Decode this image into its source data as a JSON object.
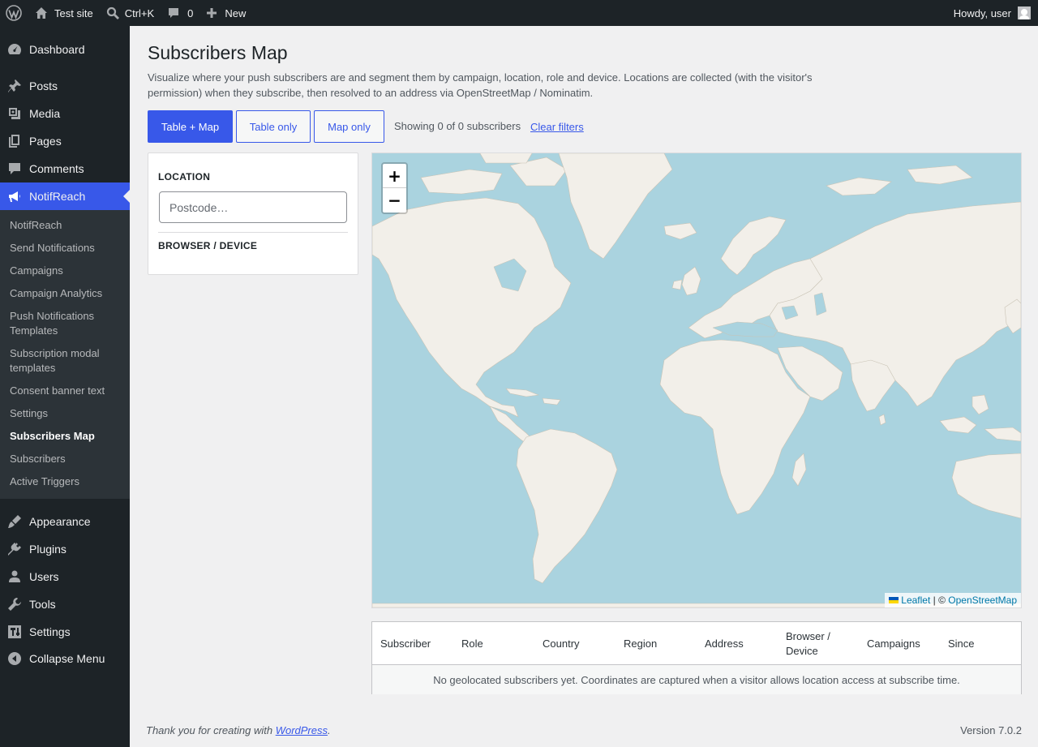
{
  "admin_bar": {
    "site_name": "Test site",
    "search_shortcut": "Ctrl+K",
    "comments_count": "0",
    "new_label": "New",
    "howdy": "Howdy, user"
  },
  "sidebar": {
    "top_items": [
      {
        "label": "Dashboard",
        "icon": "dashboard-icon"
      },
      {
        "label": "Posts",
        "icon": "pushpin-icon"
      },
      {
        "label": "Media",
        "icon": "media-icon"
      },
      {
        "label": "Pages",
        "icon": "pages-icon"
      },
      {
        "label": "Comments",
        "icon": "comment-icon"
      },
      {
        "label": "NotifReach",
        "icon": "megaphone-icon",
        "current": true
      }
    ],
    "submenu": [
      "NotifReach",
      "Send Notifications",
      "Campaigns",
      "Campaign Analytics",
      "Push Notifications Templates",
      "Subscription modal templates",
      "Consent banner text",
      "Settings",
      "Subscribers Map",
      "Subscribers",
      "Active Triggers"
    ],
    "bottom_items": [
      {
        "label": "Appearance",
        "icon": "paintbrush-icon"
      },
      {
        "label": "Plugins",
        "icon": "plugin-icon"
      },
      {
        "label": "Users",
        "icon": "users-icon"
      },
      {
        "label": "Tools",
        "icon": "wrench-icon"
      },
      {
        "label": "Settings",
        "icon": "settings-icon"
      },
      {
        "label": "Collapse Menu",
        "icon": "collapse-icon"
      }
    ]
  },
  "page": {
    "title": "Subscribers Map",
    "description": "Visualize where your push subscribers are and segment them by campaign, location, role and device. Locations are collected (with the visitor's permission) when they subscribe, then resolved to an address via OpenStreetMap / Nominatim.",
    "view_buttons": [
      "Table + Map",
      "Table only",
      "Map only"
    ],
    "active_view": "Table + Map",
    "showing": "Showing 0 of 0 subscribers",
    "clear_filters": "Clear filters"
  },
  "filters": {
    "location_label": "LOCATION",
    "postcode_placeholder": "Postcode…",
    "browser_label": "BROWSER / DEVICE"
  },
  "map": {
    "zoom_in": "+",
    "zoom_out": "−",
    "attribution_leaflet": "Leaflet",
    "attribution_sep": " | © ",
    "attribution_osm": "OpenStreetMap"
  },
  "table": {
    "headers": [
      "Subscriber",
      "Role",
      "Country",
      "Region",
      "Address",
      "Browser / Device",
      "Campaigns",
      "Since"
    ],
    "empty_message": "No geolocated subscribers yet. Coordinates are captured when a visitor allows location access at subscribe time."
  },
  "footer": {
    "thanks_prefix": "Thank you for creating with ",
    "thanks_link": "WordPress",
    "thanks_suffix": ".",
    "version": "Version 7.0.2"
  },
  "colors": {
    "accent": "#3858e9",
    "adminbar": "#1d2327",
    "map_water": "#aad3df",
    "map_land": "#f2efe9"
  }
}
